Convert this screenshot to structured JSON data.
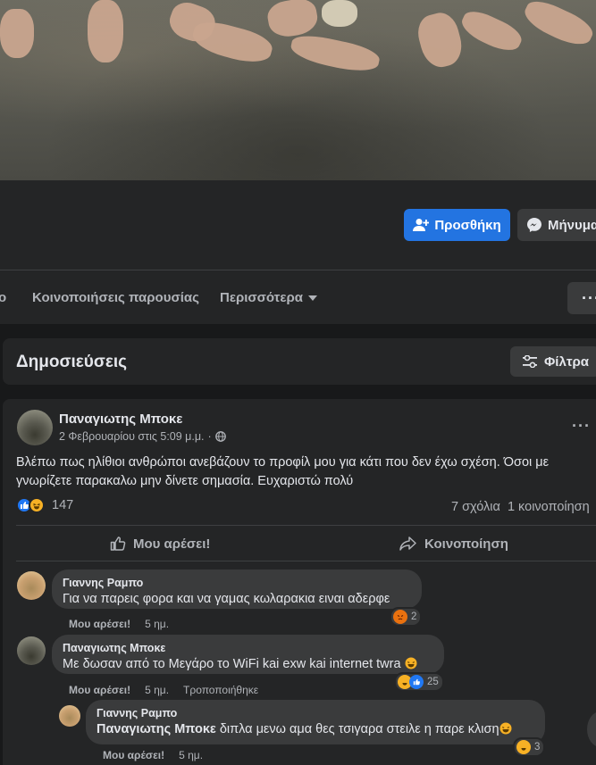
{
  "actions": {
    "add_label": "Προσθήκη",
    "message_label": "Μήνυμα"
  },
  "tabs": {
    "partial_left": "ο",
    "presence_shares": "Κοινοποιήσεις παρουσίας",
    "more": "Περισσότερα",
    "dots": "···"
  },
  "posts_section": {
    "title": "Δημοσιεύσεις",
    "filter_label": "Φίλτρα"
  },
  "post": {
    "author": "Παναγιωτης Μποκε",
    "date": "2 Φεβρουαρίου στις 5:09 μ.μ.",
    "separator": "·",
    "dots": "···",
    "text": "Βλέπω πως ηλίθιοι ανθρώποι ανεβάζουν το προφίλ μου για κάτι που δεν έχω σχέση. Όσοι με γνωρίζετε παρακαλω μην δίνετε σημασία. Ευχαριστώ πολύ",
    "reaction_count": "147",
    "comments_count": "7 σχόλια",
    "shares_count": "1 κοινοποίηση",
    "like_action": "Μου αρέσει!",
    "share_action": "Κοινοποίηση"
  },
  "comments": [
    {
      "author": "Γιαννης Ραμπο",
      "text": "Για να παρεις φορα και να γαμας κωλαρακια ειναι αδερφε",
      "like": "Μου αρέσει!",
      "time": "5 ημ.",
      "edited": "",
      "reaction_count": "2"
    },
    {
      "author": "Παναγιωτης Μποκε",
      "text": "Με δωσαν από το Μεγάρο το WiFi kai exw kai internet twra",
      "like": "Μου αρέσει!",
      "time": "5 ημ.",
      "edited": "Τροποποιήθηκε",
      "reaction_count": "25"
    },
    {
      "author": "Γιαννης Ραμπο",
      "mention": "Παναγιωτης Μποκε",
      "text": "διπλα μενω αμα θες τσιγαρα στειλε η παρε κλιση",
      "like": "Μου αρέσει!",
      "time": "5 ημ.",
      "edited": "",
      "reaction_count": "3"
    }
  ],
  "colors": {
    "primary_button": "#2374e1",
    "surface": "#242526",
    "background": "#18191a",
    "bubble": "#3a3b3c"
  }
}
